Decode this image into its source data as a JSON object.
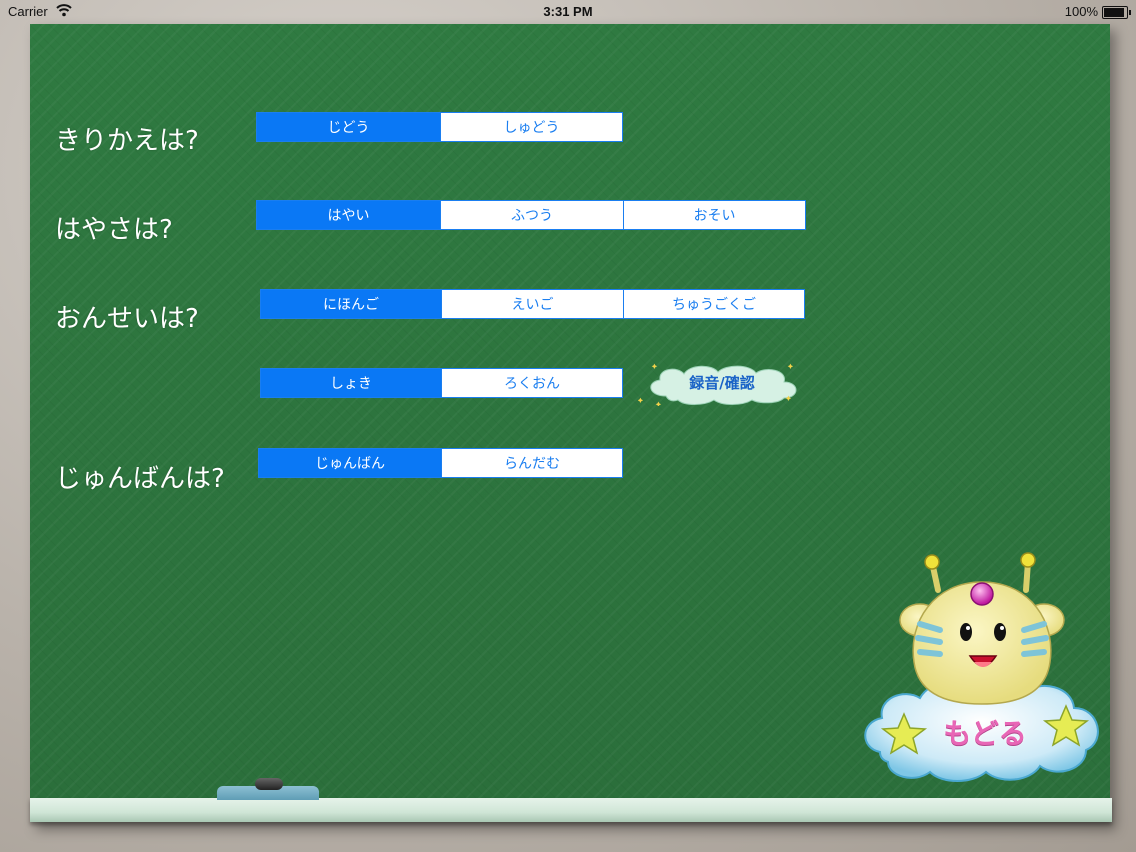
{
  "status_bar": {
    "carrier": "Carrier",
    "time": "3:31 PM",
    "battery": "100%",
    "battery_level": 1.0
  },
  "settings": [
    {
      "label": "きりかえは?",
      "options": [
        "じどう",
        "しゅどう"
      ],
      "selected": 0
    },
    {
      "label": "はやさは?",
      "options": [
        "はやい",
        "ふつう",
        "おそい"
      ],
      "selected": 0
    },
    {
      "label": "おんせいは?",
      "options": [
        "にほんご",
        "えいご",
        "ちゅうごくご"
      ],
      "selected": 0
    },
    {
      "label": "",
      "options": [
        "しょき",
        "ろくおん"
      ],
      "selected": 0
    },
    {
      "label": "じゅんばんは?",
      "options": [
        "じゅんばん",
        "らんだむ"
      ],
      "selected": 0
    }
  ],
  "record_button": {
    "label": "録音/確認"
  },
  "back_button": {
    "label": "もどる"
  },
  "colors": {
    "board": "#2f7a41",
    "accent": "#0a78f5",
    "back_text": "#e866b6"
  }
}
